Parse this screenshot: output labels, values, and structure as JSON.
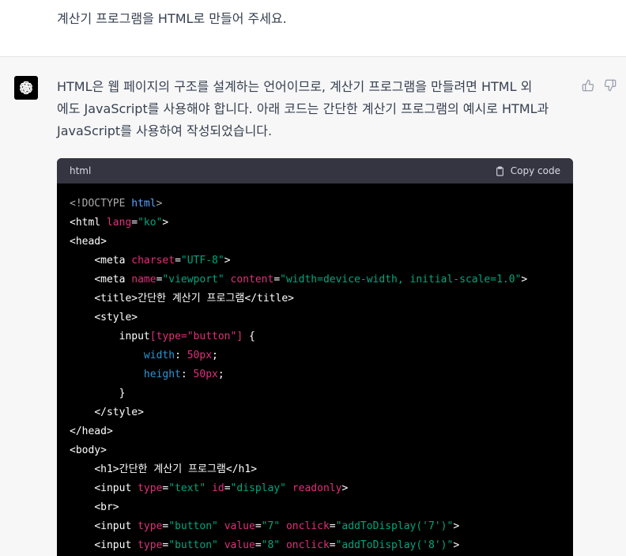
{
  "user_message": "계산기 프로그램을 HTML로 만들어 주세요.",
  "assistant": {
    "avatar_icon": "openai-logo-icon",
    "answer_lines": [
      "HTML은 웹 페이지의 구조를 설계하는 언어이므로, 계산기 프로그램을 만들려면 HTML 외",
      "에도 JavaScript를 사용해야 합니다. 아래 코드는 간단한 계산기 프로그램의 예시로 HTML과",
      "JavaScript를 사용하여 작성되었습니다."
    ],
    "feedback": {
      "up_icon": "thumbs-up-icon",
      "down_icon": "thumbs-down-icon"
    }
  },
  "code_block": {
    "language": "html",
    "copy_label": "Copy code",
    "copy_icon": "clipboard-icon",
    "lines": [
      [
        [
          "doctype",
          "<!DOCTYPE "
        ],
        [
          "kw",
          "html"
        ],
        [
          "doctype",
          ">"
        ]
      ],
      [
        [
          "tag",
          "<html "
        ],
        [
          "attr",
          "lang"
        ],
        [
          "punct",
          "="
        ],
        [
          "str",
          "\"ko\""
        ],
        [
          "tag",
          ">"
        ]
      ],
      [
        [
          "tag",
          "<head>"
        ]
      ],
      [
        [
          "text",
          "    "
        ],
        [
          "tag",
          "<meta "
        ],
        [
          "attr",
          "charset"
        ],
        [
          "punct",
          "="
        ],
        [
          "str",
          "\"UTF-8\""
        ],
        [
          "tag",
          ">"
        ]
      ],
      [
        [
          "text",
          "    "
        ],
        [
          "tag",
          "<meta "
        ],
        [
          "attr",
          "name"
        ],
        [
          "punct",
          "="
        ],
        [
          "str",
          "\"viewport\""
        ],
        [
          "text",
          " "
        ],
        [
          "attr",
          "content"
        ],
        [
          "punct",
          "="
        ],
        [
          "str",
          "\"width=device-width, initial-scale=1.0\""
        ],
        [
          "tag",
          ">"
        ]
      ],
      [
        [
          "text",
          "    "
        ],
        [
          "tag",
          "<title>"
        ],
        [
          "text",
          "간단한 계산기 프로그램"
        ],
        [
          "tag",
          "</title>"
        ]
      ],
      [
        [
          "text",
          "    "
        ],
        [
          "tag",
          "<style>"
        ]
      ],
      [
        [
          "text",
          "        "
        ],
        [
          "tag",
          "input"
        ],
        [
          "attr",
          "[type=\"button\"]"
        ],
        [
          "text",
          " {"
        ]
      ],
      [
        [
          "text",
          "            "
        ],
        [
          "prop",
          "width"
        ],
        [
          "text",
          ": "
        ],
        [
          "num",
          "50px"
        ],
        [
          "text",
          ";"
        ]
      ],
      [
        [
          "text",
          "            "
        ],
        [
          "prop",
          "height"
        ],
        [
          "text",
          ": "
        ],
        [
          "num",
          "50px"
        ],
        [
          "text",
          ";"
        ]
      ],
      [
        [
          "text",
          "        }"
        ]
      ],
      [
        [
          "text",
          "    "
        ],
        [
          "tag",
          "</style>"
        ]
      ],
      [
        [
          "tag",
          "</head>"
        ]
      ],
      [
        [
          "tag",
          "<body>"
        ]
      ],
      [
        [
          "text",
          "    "
        ],
        [
          "tag",
          "<h1>"
        ],
        [
          "text",
          "간단한 계산기 프로그램"
        ],
        [
          "tag",
          "</h1>"
        ]
      ],
      [
        [
          "text",
          "    "
        ],
        [
          "tag",
          "<input "
        ],
        [
          "attr",
          "type"
        ],
        [
          "punct",
          "="
        ],
        [
          "str",
          "\"text\""
        ],
        [
          "text",
          " "
        ],
        [
          "attr",
          "id"
        ],
        [
          "punct",
          "="
        ],
        [
          "str",
          "\"display\""
        ],
        [
          "text",
          " "
        ],
        [
          "attr",
          "readonly"
        ],
        [
          "tag",
          ">"
        ]
      ],
      [
        [
          "text",
          "    "
        ],
        [
          "tag",
          "<br>"
        ]
      ],
      [
        [
          "text",
          "    "
        ],
        [
          "tag",
          "<input "
        ],
        [
          "attr",
          "type"
        ],
        [
          "punct",
          "="
        ],
        [
          "str",
          "\"button\""
        ],
        [
          "text",
          " "
        ],
        [
          "attr",
          "value"
        ],
        [
          "punct",
          "="
        ],
        [
          "str",
          "\"7\""
        ],
        [
          "text",
          " "
        ],
        [
          "attr",
          "onclick"
        ],
        [
          "punct",
          "="
        ],
        [
          "str",
          "\"addToDisplay('7')\""
        ],
        [
          "tag",
          ">"
        ]
      ],
      [
        [
          "text",
          "    "
        ],
        [
          "tag",
          "<input "
        ],
        [
          "attr",
          "type"
        ],
        [
          "punct",
          "="
        ],
        [
          "str",
          "\"button\""
        ],
        [
          "text",
          " "
        ],
        [
          "attr",
          "value"
        ],
        [
          "punct",
          "="
        ],
        [
          "str",
          "\"8\""
        ],
        [
          "text",
          " "
        ],
        [
          "attr",
          "onclick"
        ],
        [
          "punct",
          "="
        ],
        [
          "str",
          "\"addToDisplay('8')\""
        ],
        [
          "tag",
          ">"
        ]
      ]
    ]
  }
}
